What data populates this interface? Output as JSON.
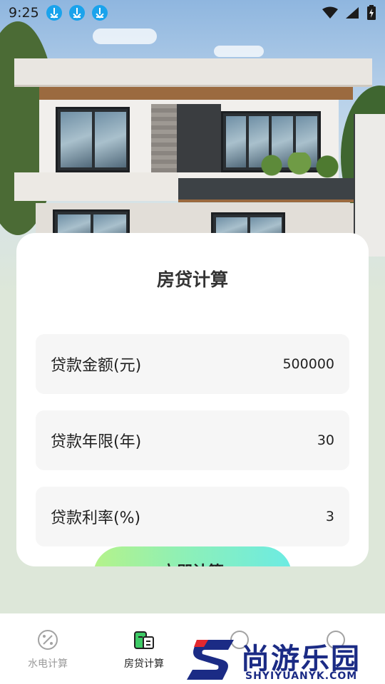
{
  "status_bar": {
    "time": "9:25",
    "icons": [
      "download-icon",
      "download-icon",
      "download-icon",
      "wifi-icon",
      "signal-icon",
      "battery-icon"
    ]
  },
  "hero": {
    "image": "modern-house-photo"
  },
  "card": {
    "title": "房贷计算",
    "fields": [
      {
        "label": "贷款金额(元)",
        "value": "500000"
      },
      {
        "label": "贷款年限(年)",
        "value": "30"
      },
      {
        "label": "贷款利率(%)",
        "value": "3"
      }
    ],
    "button_label": "立即计算"
  },
  "bottom_nav": {
    "items": [
      {
        "label": "水电计算",
        "icon": "percent-calculator-icon",
        "active": false
      },
      {
        "label": "房贷计算",
        "icon": "house-loan-icon",
        "active": true
      },
      {
        "label": "",
        "icon": "partial-icon",
        "active": false
      },
      {
        "label": "",
        "icon": "partial-icon",
        "active": false
      }
    ]
  },
  "watermark": {
    "logo_letter": "S",
    "text": "尚游乐园",
    "sub": "SHYIYUANYK.COM"
  },
  "colors": {
    "page_bg": "#dde7d9",
    "card_bg": "#ffffff",
    "field_bg": "#f6f6f6",
    "active_nav": "#2dbd5a",
    "download_badge": "#1aa3ec",
    "watermark": "#1b2b85"
  }
}
